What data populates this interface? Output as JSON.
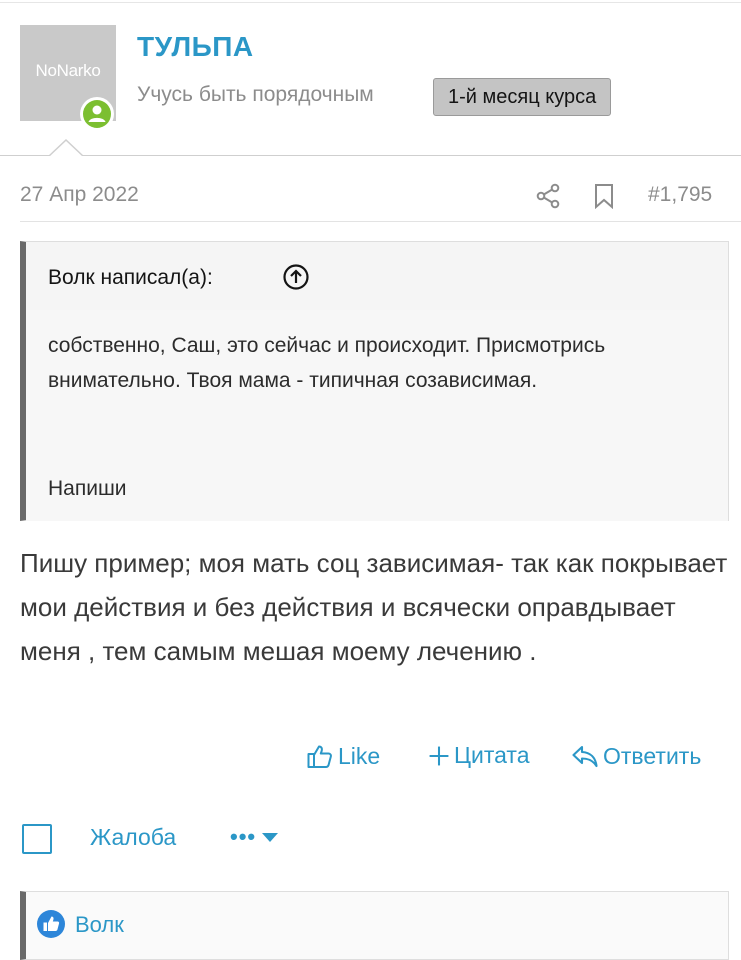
{
  "user": {
    "avatar_text": "NoNarko",
    "name": "ТУЛЬПА",
    "title": "Учусь быть порядочным",
    "badge": "1-й месяц курса",
    "online": true
  },
  "post": {
    "date": "27 Апр 2022",
    "number": "#1,795"
  },
  "quote": {
    "author": "Волк написал(а):",
    "text": "собственно, Саш, это сейчас и происходит. Присмотрись внимательно. Твоя мама - типичная созависимая.",
    "extra": "Напиши"
  },
  "message": {
    "text": "Пишу пример; моя мать соц зависимая- так как покрывает мои действия и без действия и всячески оправдывает меня , тем самым мешая моему лечению ."
  },
  "actions": {
    "like": "Like",
    "quote": "Цитата",
    "reply": "Ответить",
    "report": "Жалоба",
    "more": "•••"
  },
  "reactions": {
    "user": "Волк"
  },
  "colors": {
    "accent": "#2b97c7",
    "online": "#7cbf31",
    "quote_bar": "#6a6a6a"
  },
  "icons": [
    "online-icon",
    "share-icon",
    "bookmark-icon",
    "arrow-up-circle-icon",
    "thumbs-up-icon",
    "plus-icon",
    "reply-icon",
    "chevron-down-icon",
    "like-reaction-icon"
  ]
}
